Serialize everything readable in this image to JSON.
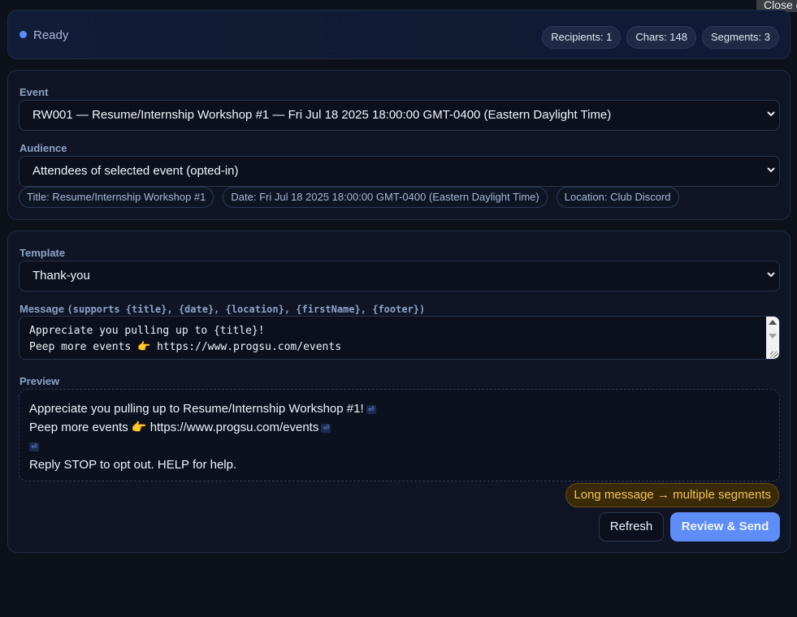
{
  "tooltip": "Close c",
  "status": {
    "text": "Ready",
    "accent": "#5b8cff",
    "pills": {
      "recipients": "Recipients: 1",
      "chars": "Chars: 148",
      "segments": "Segments: 3"
    }
  },
  "event_section": {
    "event_label": "Event",
    "event_value": "RW001 — Resume/Internship Workshop #1 — Fri Jul 18 2025 18:00:00 GMT-0400 (Eastern Daylight Time)",
    "audience_label": "Audience",
    "audience_value": "Attendees of selected event (opted-in)",
    "chips": {
      "title": "Title: Resume/Internship Workshop #1",
      "date": "Date: Fri Jul 18 2025 18:00:00 GMT-0400 (Eastern Daylight Time)",
      "location": "Location: Club Discord"
    }
  },
  "message_section": {
    "template_label": "Template",
    "template_value": "Thank-you",
    "message_label": "Message",
    "message_hint": "(supports {title}, {date}, {location}, {firstName}, {footer})",
    "message_line1": "Appreciate you pulling up to {title}!",
    "message_line2": "Peep more events 👉 https://www.progsu.com/events",
    "preview_label": "Preview",
    "preview_line1": "Appreciate you pulling up to Resume/Internship Workshop #1!",
    "preview_line2": "Peep more events 👉 https://www.progsu.com/events",
    "preview_line4": "Reply STOP to opt out. HELP for help.",
    "newline_glyph": "⏎",
    "warning": "Long message → multiple segments",
    "refresh_label": "Refresh",
    "send_label": "Review & Send"
  }
}
